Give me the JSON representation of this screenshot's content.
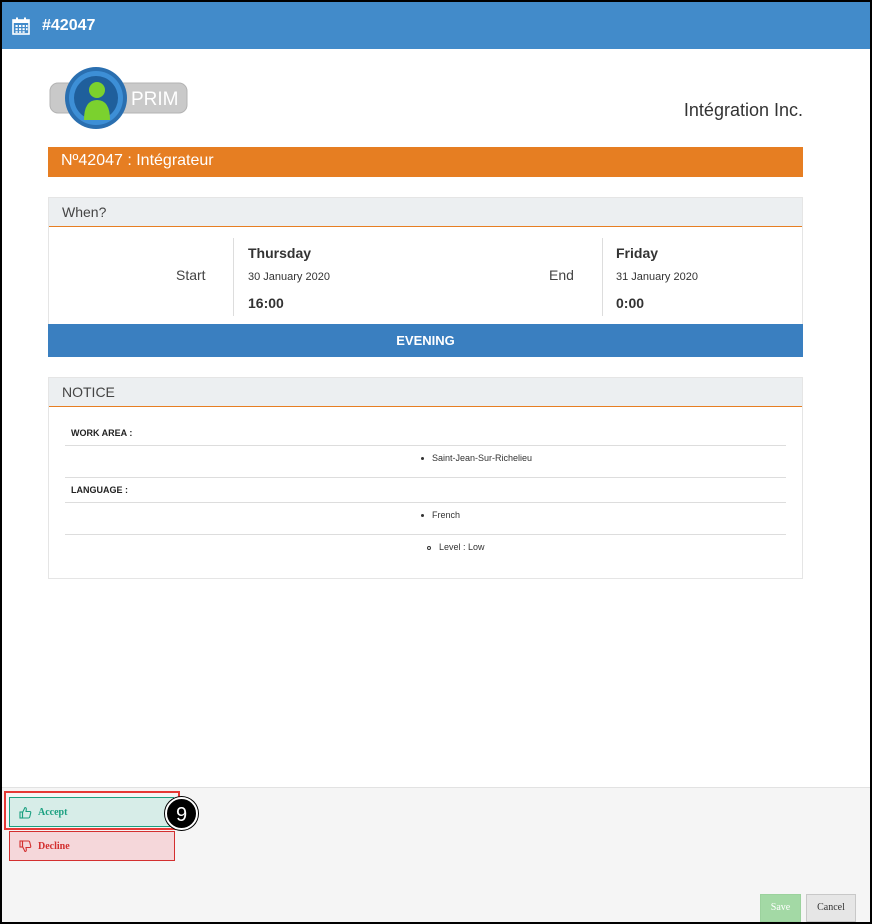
{
  "header": {
    "title": "#42047",
    "icon": "calendar-icon",
    "color": "#428bca"
  },
  "logo": {
    "text": "PRIM"
  },
  "company": {
    "name": "Intégration Inc."
  },
  "job": {
    "title": "Nº42047 : Intégrateur",
    "color": "#e67e22"
  },
  "when": {
    "heading": "When?",
    "start": {
      "label": "Start",
      "day": "Thursday",
      "date": "30 January 2020",
      "time": "16:00"
    },
    "end": {
      "label": "End",
      "day": "Friday",
      "date": "31 January 2020",
      "time": "0:00"
    }
  },
  "shift": {
    "label": "EVENING",
    "color": "#3a7fc0"
  },
  "notice": {
    "heading": "NOTICE",
    "work_area": {
      "label": "WORK AREA :",
      "items": [
        "Saint-Jean-Sur-Richelieu"
      ]
    },
    "language": {
      "label": "LANGUAGE :",
      "items": [
        "French"
      ],
      "sub_items": [
        "Level : Low"
      ]
    }
  },
  "footer": {
    "accept_label": "Accept",
    "decline_label": "Decline",
    "save_label": "Save",
    "cancel_label": "Cancel",
    "step_badge": "9",
    "accept_icon": "thumbs-up-icon",
    "decline_icon": "thumbs-down-icon"
  }
}
